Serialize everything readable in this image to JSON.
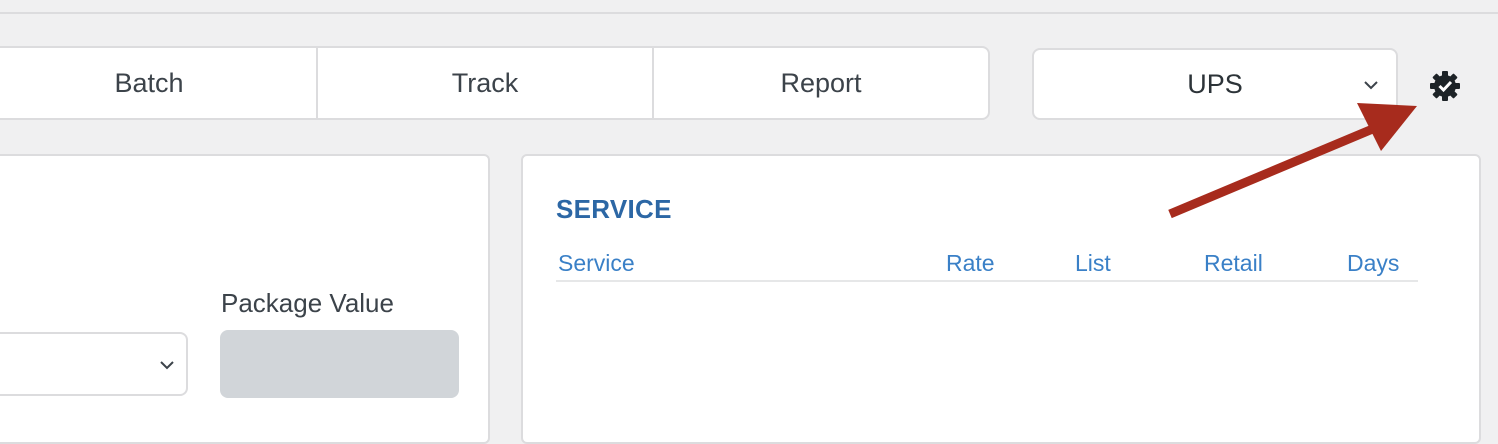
{
  "tabs": [
    {
      "label": "Batch"
    },
    {
      "label": "Track"
    },
    {
      "label": "Report"
    }
  ],
  "carrier_select": {
    "value": "UPS"
  },
  "settings": {
    "icon": "gear-check-icon"
  },
  "package": {
    "label": "Package Value",
    "value": ""
  },
  "service_panel": {
    "title": "SERVICE",
    "columns": [
      "Service",
      "Rate",
      "List",
      "Retail",
      "Days"
    ]
  },
  "colors": {
    "accent_title": "#2c67a5",
    "column_header": "#3a80c7",
    "annotation_arrow": "#a72b1d"
  }
}
